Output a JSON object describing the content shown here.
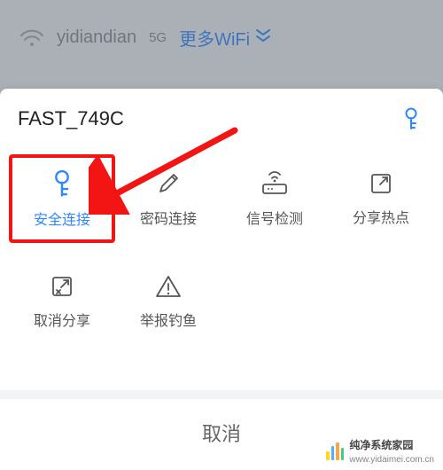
{
  "backdrop": {
    "ssid": "yidiandian",
    "band": "5G",
    "more_label": "更多WiFi"
  },
  "sheet": {
    "title": "FAST_749C",
    "cancel_label": "取消",
    "actions": [
      {
        "label": "安全连接",
        "icon": "key-icon",
        "highlight": true
      },
      {
        "label": "密码连接",
        "icon": "pencil-icon",
        "highlight": false
      },
      {
        "label": "信号检测",
        "icon": "router-icon",
        "highlight": false
      },
      {
        "label": "分享热点",
        "icon": "share-icon",
        "highlight": false
      },
      {
        "label": "取消分享",
        "icon": "unshare-icon",
        "highlight": false
      },
      {
        "label": "举报钓鱼",
        "icon": "warning-icon",
        "highlight": false
      }
    ]
  },
  "colors": {
    "accent": "#2f88ff",
    "annotation": "#f31414",
    "icon_gray": "#555555"
  },
  "watermark": {
    "name": "纯净系统家园",
    "url": "www.yidaimei.com.cn"
  }
}
